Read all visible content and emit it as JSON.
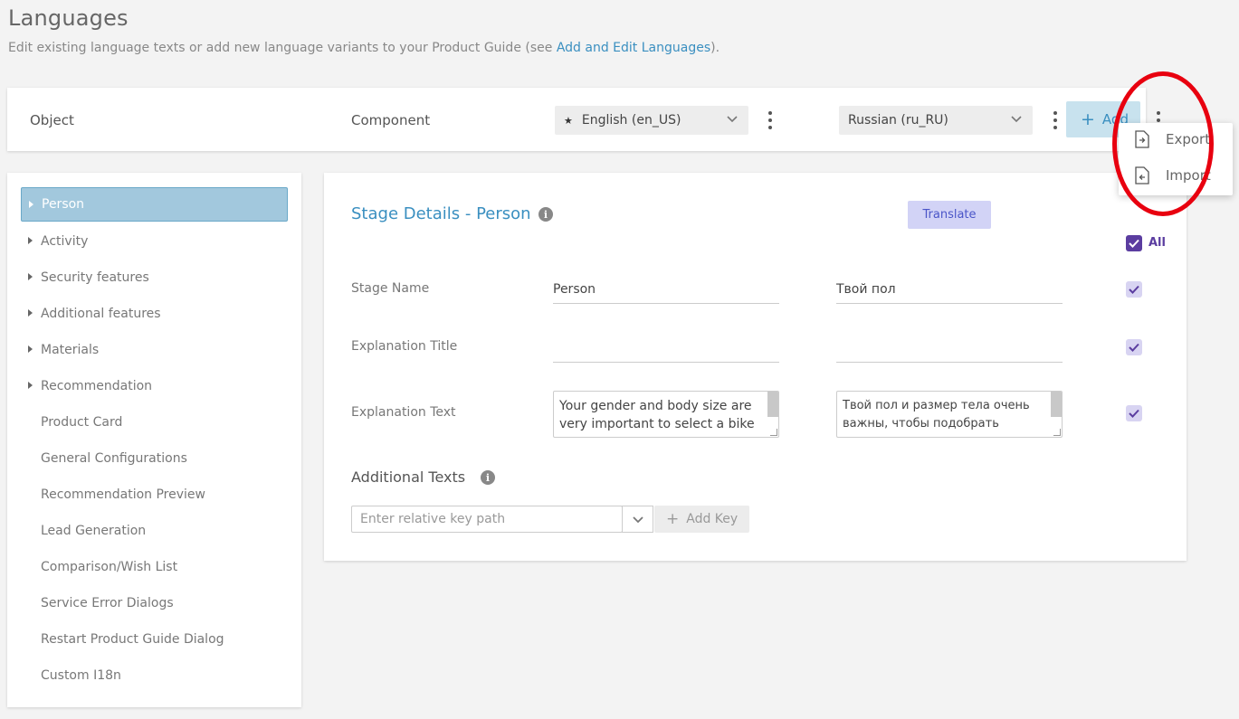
{
  "page": {
    "title": "Languages",
    "description_prefix": "Edit existing language texts or add new language variants to your Product Guide (see ",
    "description_link": "Add and Edit Languages",
    "description_suffix": ")."
  },
  "header": {
    "object_label": "Object",
    "component_label": "Component",
    "primary_language": "English (en_US)",
    "secondary_language": "Russian (ru_RU)",
    "add_label": "Add"
  },
  "menu": {
    "items": [
      {
        "label": "Export",
        "icon": "export-file-icon"
      },
      {
        "label": "Import",
        "icon": "import-file-icon"
      }
    ]
  },
  "sidebar": {
    "items": [
      {
        "label": "Person",
        "expandable": true,
        "selected": true
      },
      {
        "label": "Activity",
        "expandable": true
      },
      {
        "label": "Security features",
        "expandable": true
      },
      {
        "label": "Additional features",
        "expandable": true
      },
      {
        "label": "Materials",
        "expandable": true
      },
      {
        "label": "Recommendation",
        "expandable": true
      },
      {
        "label": "Product Card",
        "expandable": false
      },
      {
        "label": "General Configurations",
        "expandable": false
      },
      {
        "label": "Recommendation Preview",
        "expandable": false
      },
      {
        "label": "Lead Generation",
        "expandable": false
      },
      {
        "label": "Comparison/Wish List",
        "expandable": false
      },
      {
        "label": "Service Error Dialogs",
        "expandable": false
      },
      {
        "label": "Restart Product Guide Dialog",
        "expandable": false
      },
      {
        "label": "Custom I18n",
        "expandable": false
      }
    ]
  },
  "panel": {
    "title": "Stage Details - Person",
    "translate_label": "Translate",
    "all_label": "All",
    "fields": {
      "stage_name": {
        "label": "Stage Name",
        "en": "Person",
        "ru": "Твой пол"
      },
      "explanation_title": {
        "label": "Explanation Title",
        "en": "",
        "ru": ""
      },
      "explanation_text": {
        "label": "Explanation Text",
        "en": "Your gender and body size are very important to select a bike",
        "ru": "Твой пол и размер тела очень важны, чтобы подобрать"
      }
    },
    "additional_texts_label": "Additional Texts",
    "key_placeholder": "Enter relative key path",
    "add_key_label": "Add Key"
  },
  "colors": {
    "accent": "#3a8fc0",
    "checkbox": "#5b3da0",
    "annotation": "#e8000f"
  }
}
